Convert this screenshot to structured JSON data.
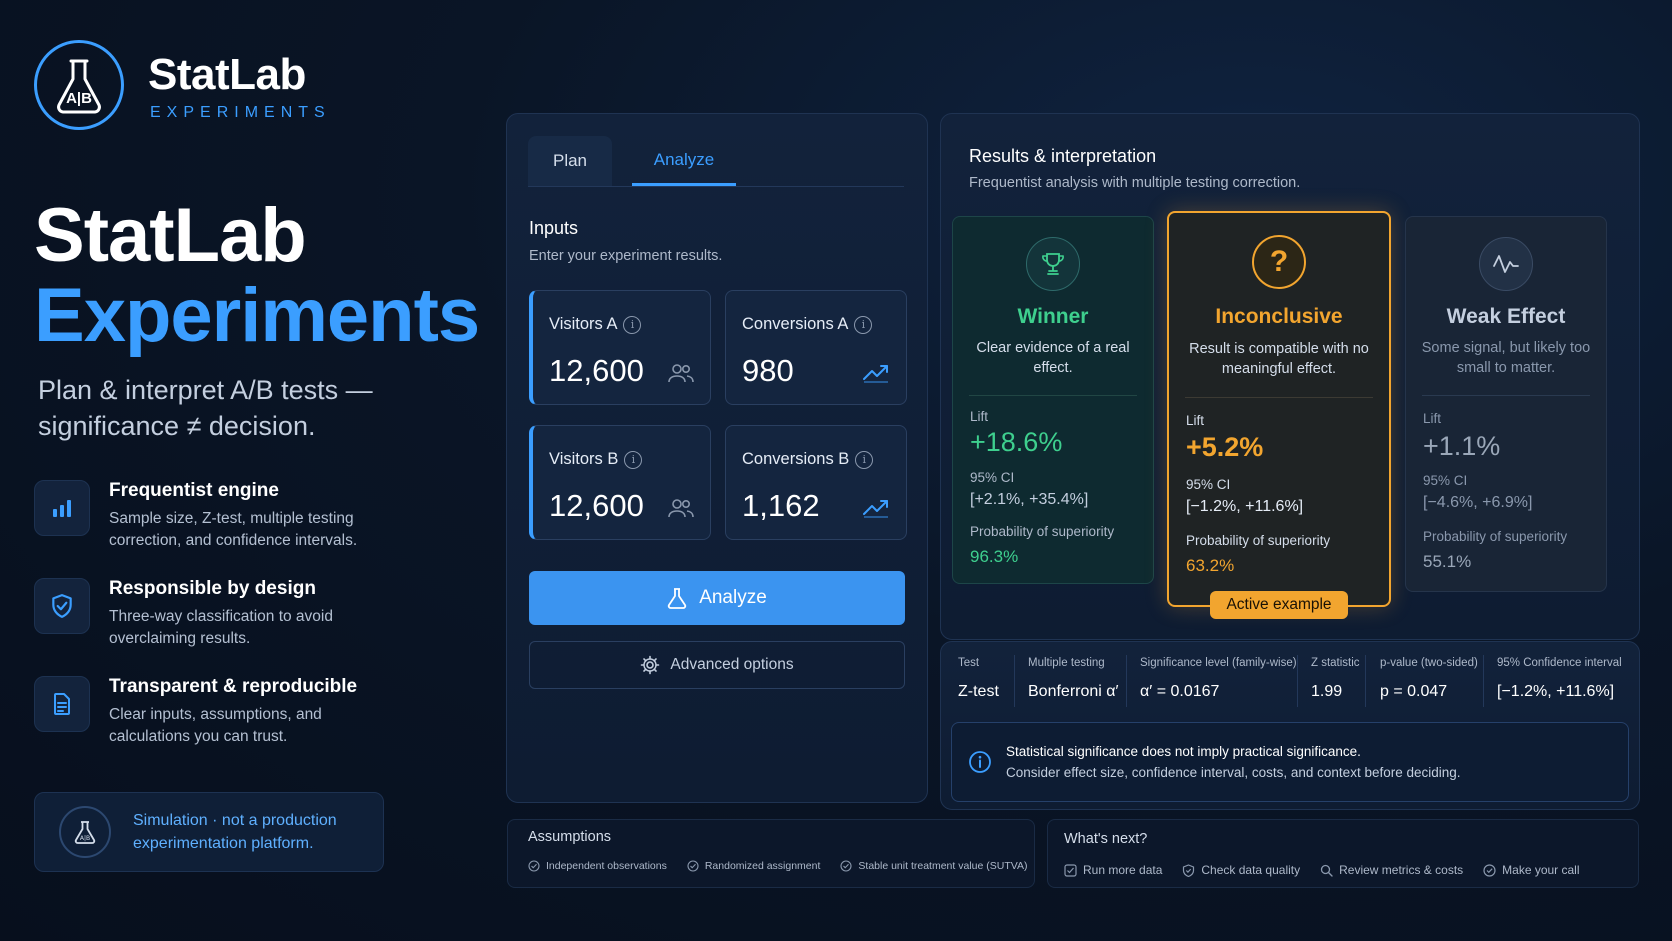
{
  "brand": {
    "name": "StatLab",
    "tagline": "EXPERIMENTS",
    "logo_text": "A|B"
  },
  "hero": {
    "title_line1": "StatLab",
    "title_line2": "Experiments",
    "subtitle": "Plan & interpret A/B tests — significance ≠ decision."
  },
  "features": [
    {
      "icon": "bar-chart-icon",
      "title": "Frequentist engine",
      "desc": "Sample size, Z-test, multiple testing correction, and confidence intervals."
    },
    {
      "icon": "shield-check-icon",
      "title": "Responsible by design",
      "desc": "Three-way classification to avoid overclaiming results."
    },
    {
      "icon": "document-icon",
      "title": "Transparent & reproducible",
      "desc": "Clear inputs, assumptions, and calculations you can trust."
    }
  ],
  "simulation_note": "Simulation · not a production experimentation platform.",
  "tabs": [
    {
      "label": "Plan",
      "active": false
    },
    {
      "label": "Analyze",
      "active": true
    }
  ],
  "inputs": {
    "title": "Inputs",
    "desc": "Enter your experiment results.",
    "fields": [
      {
        "label": "Visitors A",
        "value": "12,600",
        "icon": "users-icon"
      },
      {
        "label": "Conversions A",
        "value": "980",
        "icon": "trend-up-icon"
      },
      {
        "label": "Visitors B",
        "value": "12,600",
        "icon": "users-icon"
      },
      {
        "label": "Conversions B",
        "value": "1,162",
        "icon": "trend-up-icon"
      }
    ],
    "analyze_label": "Analyze",
    "advanced_label": "Advanced options"
  },
  "results": {
    "title": "Results & interpretation",
    "desc": "Frequentist analysis with multiple testing correction.",
    "cards": [
      {
        "key": "winner",
        "icon": "trophy-icon",
        "title": "Winner",
        "desc": "Clear evidence of a real effect.",
        "lift_label": "Lift",
        "lift": "+18.6%",
        "ci_label": "95% CI",
        "ci": "[+2.1%, +35.4%]",
        "prob_label": "Probability of superiority",
        "prob": "96.3%",
        "color": "#3ecf8e"
      },
      {
        "key": "inconclusive",
        "icon": "question-icon",
        "title": "Inconclusive",
        "desc": "Result is compatible with no meaningful effect.",
        "lift_label": "Lift",
        "lift": "+5.2%",
        "ci_label": "95% CI",
        "ci": "[−1.2%, +11.6%]",
        "prob_label": "Probability of superiority",
        "prob": "63.2%",
        "color": "#f2a52f"
      },
      {
        "key": "weak",
        "icon": "wave-icon",
        "title": "Weak Effect",
        "desc": "Some signal, but likely too small to matter.",
        "lift_label": "Lift",
        "lift": "+1.1%",
        "ci_label": "95% CI",
        "ci": "[−4.6%, +6.9%]",
        "prob_label": "Probability of superiority",
        "prob": "55.1%",
        "color": "#9aa7b8"
      }
    ],
    "active_badge": "Active example"
  },
  "stats": [
    {
      "head": "Test",
      "value": "Z-test"
    },
    {
      "head": "Multiple testing",
      "value": "Bonferroni α′"
    },
    {
      "head": "Significance level (family-wise)",
      "value": "α′ = 0.0167"
    },
    {
      "head": "Z statistic",
      "value": "1.99"
    },
    {
      "head": "p-value (two-sided)",
      "value": "p = 0.047"
    },
    {
      "head": "95% Confidence interval",
      "value": "[−1.2%, +11.6%]"
    }
  ],
  "note": {
    "line1": "Statistical significance does not imply practical significance.",
    "line2": "Consider effect size, confidence interval, costs, and context before deciding."
  },
  "assumptions": {
    "title": "Assumptions",
    "items": [
      "Independent observations",
      "Randomized assignment",
      "Stable unit treatment value (SUTVA)"
    ]
  },
  "next": {
    "title": "What's next?",
    "items": [
      {
        "icon": "checkbox-icon",
        "label": "Run more data"
      },
      {
        "icon": "shield-check-icon",
        "label": "Check data quality"
      },
      {
        "icon": "search-icon",
        "label": "Review metrics & costs"
      },
      {
        "icon": "check-circle-icon",
        "label": "Make your call"
      }
    ]
  }
}
